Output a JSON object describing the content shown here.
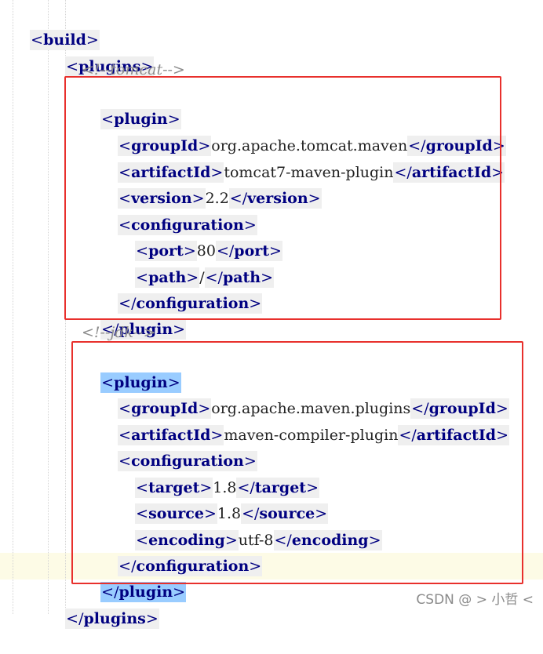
{
  "code": {
    "build_open": "build",
    "plugins_open": "plugins",
    "comment_tomcat": "<!--tomcat-->",
    "plugin_tag": "plugin",
    "groupId_tag": "groupId",
    "artifactId_tag": "artifactId",
    "version_tag": "version",
    "configuration_tag": "configuration",
    "port_tag": "port",
    "path_tag": "path",
    "target_tag": "target",
    "source_tag": "source",
    "encoding_tag": "encoding",
    "tomcat_groupId": "org.apache.tomcat.maven",
    "tomcat_artifactId": "tomcat7-maven-plugin",
    "tomcat_version": "2.2",
    "port_value": "80",
    "path_value": "/",
    "comment_jdk": "<!--jdk-->",
    "compiler_groupId": "org.apache.maven.plugins",
    "compiler_artifactId": "maven-compiler-plugin",
    "target_value": "1.8",
    "source_value": "1.8",
    "encoding_value": "utf-8"
  },
  "colors": {
    "tag": "#000080",
    "tag_bg": "#efefef",
    "match_bg": "#99ccff",
    "comment": "#8c8c8c",
    "annotation_box": "#e8302c",
    "current_line": "#fdfbe6"
  },
  "watermark": "CSDN @ > 小哲 <"
}
